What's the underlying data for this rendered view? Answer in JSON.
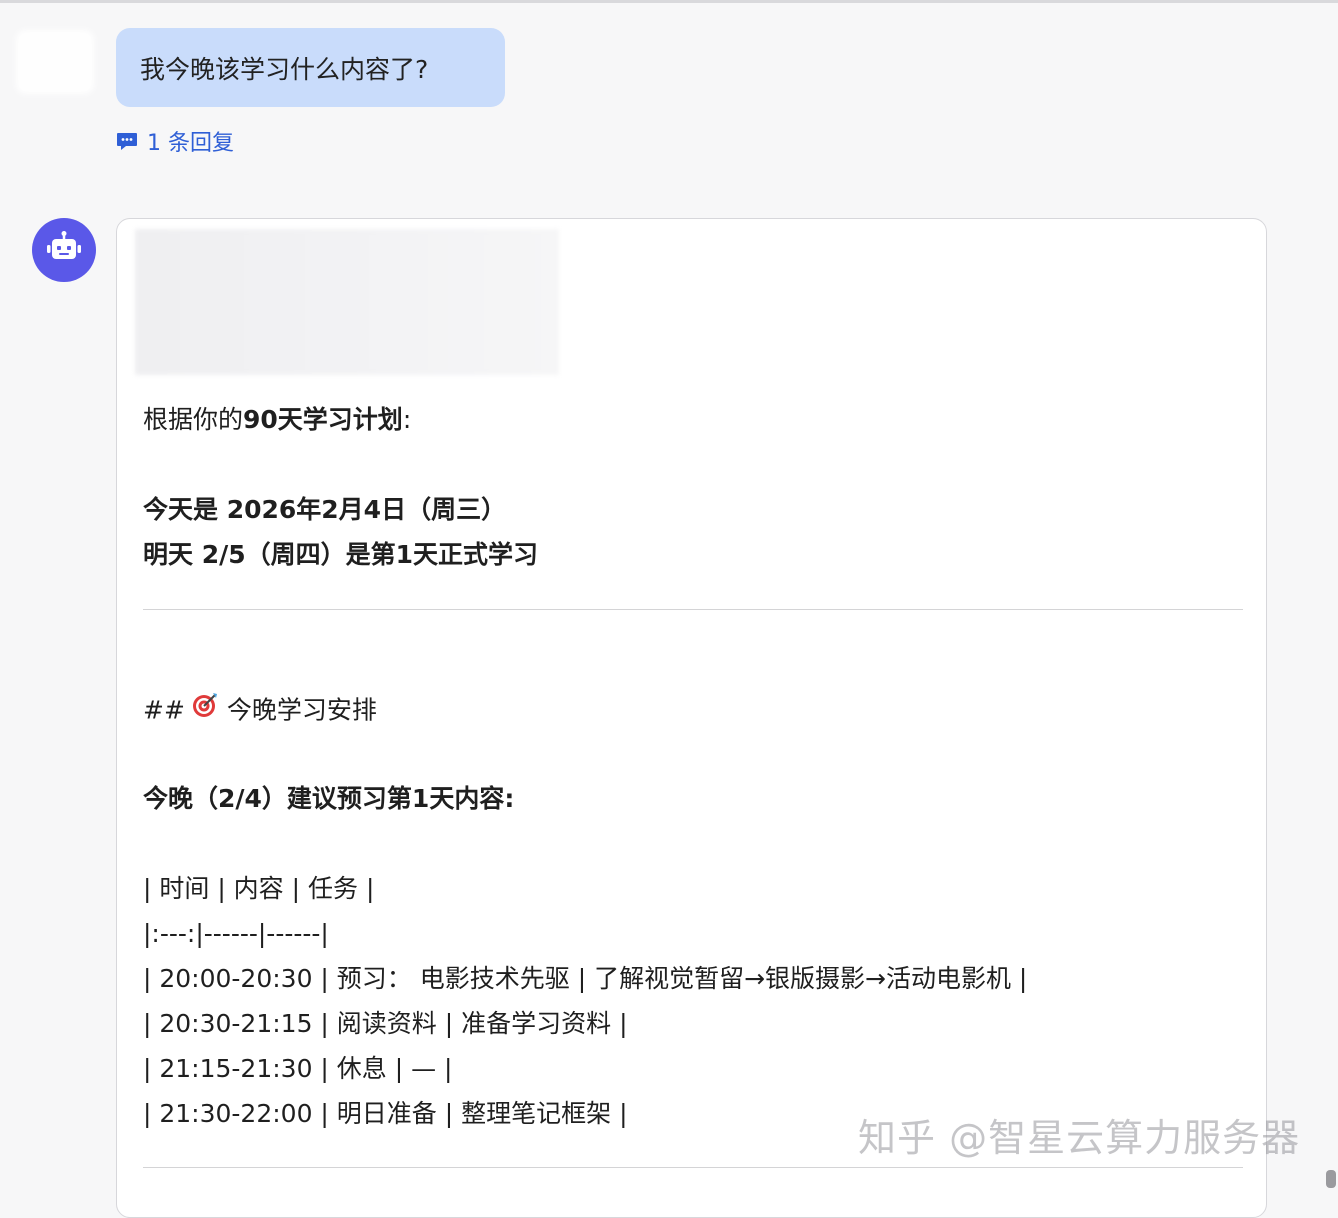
{
  "user_message": {
    "text": "我今晚该学习什么内容了?"
  },
  "reply_link": {
    "label": "1 条回复",
    "icon": "comment-icon"
  },
  "bot": {
    "avatar_icon": "robot-icon",
    "lines": {
      "intro_prefix": "根据你的",
      "intro_bold": "90天学习计划",
      "intro_suffix": ":",
      "today": "今天是 2026年2月4日（周三）",
      "tomorrow": "明天 2/5（周四）是第1天正式学习",
      "heading_prefix": "##",
      "heading_icon": "target-icon",
      "heading_text": "今晚学习安排",
      "tonight": "今晚（2/4）建议预习第1天内容:",
      "table_rows": [
        "| 时间 | 内容 | 任务 |",
        "|:---:|------|------|",
        "| 20:00-20:30 | 预习： 电影技术先驱 | 了解视觉暂留→银版摄影→活动电影机 |",
        "| 20:30-21:15 | 阅读资料 | 准备学习资料 |",
        "| 21:15-21:30 | 休息 | — |",
        "| 21:30-22:00 | 明日准备 | 整理笔记框架 |"
      ]
    }
  },
  "watermark": "知乎 @智星云算力服务器",
  "colors": {
    "user_bubble": "#c9dcfb",
    "link_blue": "#2f5fd6",
    "bot_avatar": "#5a58e8"
  }
}
